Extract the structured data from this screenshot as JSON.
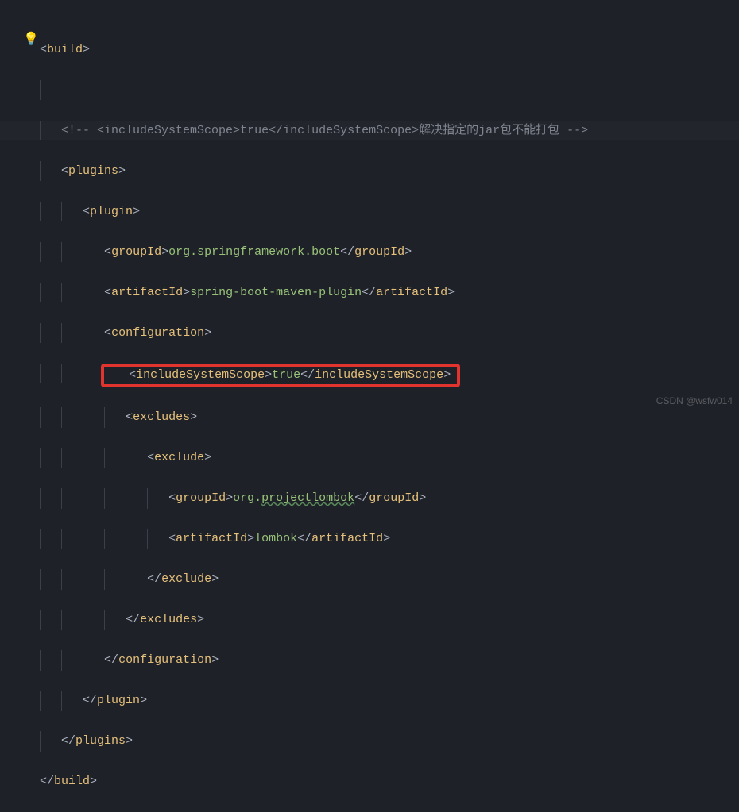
{
  "watermark": "CSDN @wsfw014",
  "code": {
    "build_open": "build",
    "comment_prefix": "<!-- ",
    "comment_inc_open": "<includeSystemScope>",
    "comment_inc_val": "true",
    "comment_inc_close": "</includeSystemScope>",
    "comment_zh": "解决指定的jar包不能打包",
    "comment_suffix": " -->",
    "plugins_open": "plugins",
    "plugin_open": "plugin",
    "groupId_tag": "groupId",
    "groupId_val": "org.springframework.boot",
    "artifactId_tag": "artifactId",
    "artifactId_val": "spring-boot-maven-plugin",
    "configuration_tag": "configuration",
    "inc_tag": "includeSystemScope",
    "inc_val": "true",
    "excludes_tag": "excludes",
    "exclude_tag": "exclude",
    "ex_groupId_prefix": "org.",
    "ex_groupId_spell": "projectlombok",
    "ex_artifactId_val": "lombok",
    "plugins_close": "plugins",
    "build_close": "build"
  }
}
